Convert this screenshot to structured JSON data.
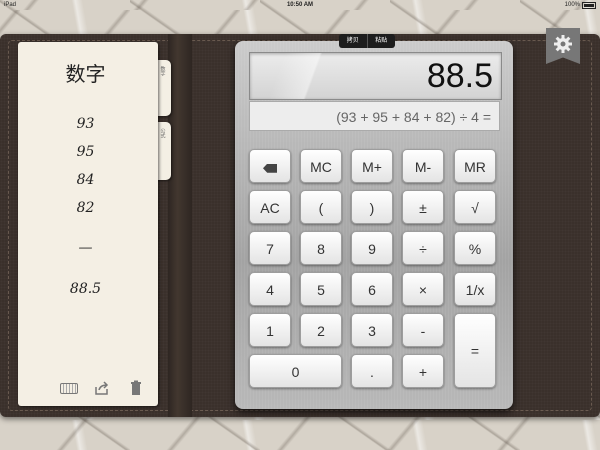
{
  "status_bar": {
    "carrier": "iPad",
    "time": "10:50 AM",
    "battery": "100%"
  },
  "notepad": {
    "title": "数字",
    "tabs": [
      "数字",
      "公式"
    ],
    "lines": [
      "93",
      "95",
      "84",
      "82",
      "—",
      "88.5"
    ],
    "tools": [
      "keyboard-icon",
      "share-icon",
      "trash-icon"
    ]
  },
  "calculator": {
    "display": "88.5",
    "expression": "(93 + 95 + 84 + 82) ÷ 4 =",
    "popup": {
      "copy": "拷贝",
      "paste": "粘贴"
    },
    "keys": {
      "backspace": "⌫",
      "mc": "MC",
      "mplus": "M+",
      "mminus": "M-",
      "mr": "MR",
      "ac": "AC",
      "lparen": "(",
      "rparen": ")",
      "plusminus": "±",
      "sqrt": "√",
      "seven": "7",
      "eight": "8",
      "nine": "9",
      "divide": "÷",
      "percent": "%",
      "four": "4",
      "five": "5",
      "six": "6",
      "multiply": "×",
      "reciprocal": "1/x",
      "one": "1",
      "two": "2",
      "three": "3",
      "minus": "-",
      "equals": "=",
      "zero": "0",
      "dot": ".",
      "plus": "+"
    }
  },
  "settings_icon": "gear-icon"
}
